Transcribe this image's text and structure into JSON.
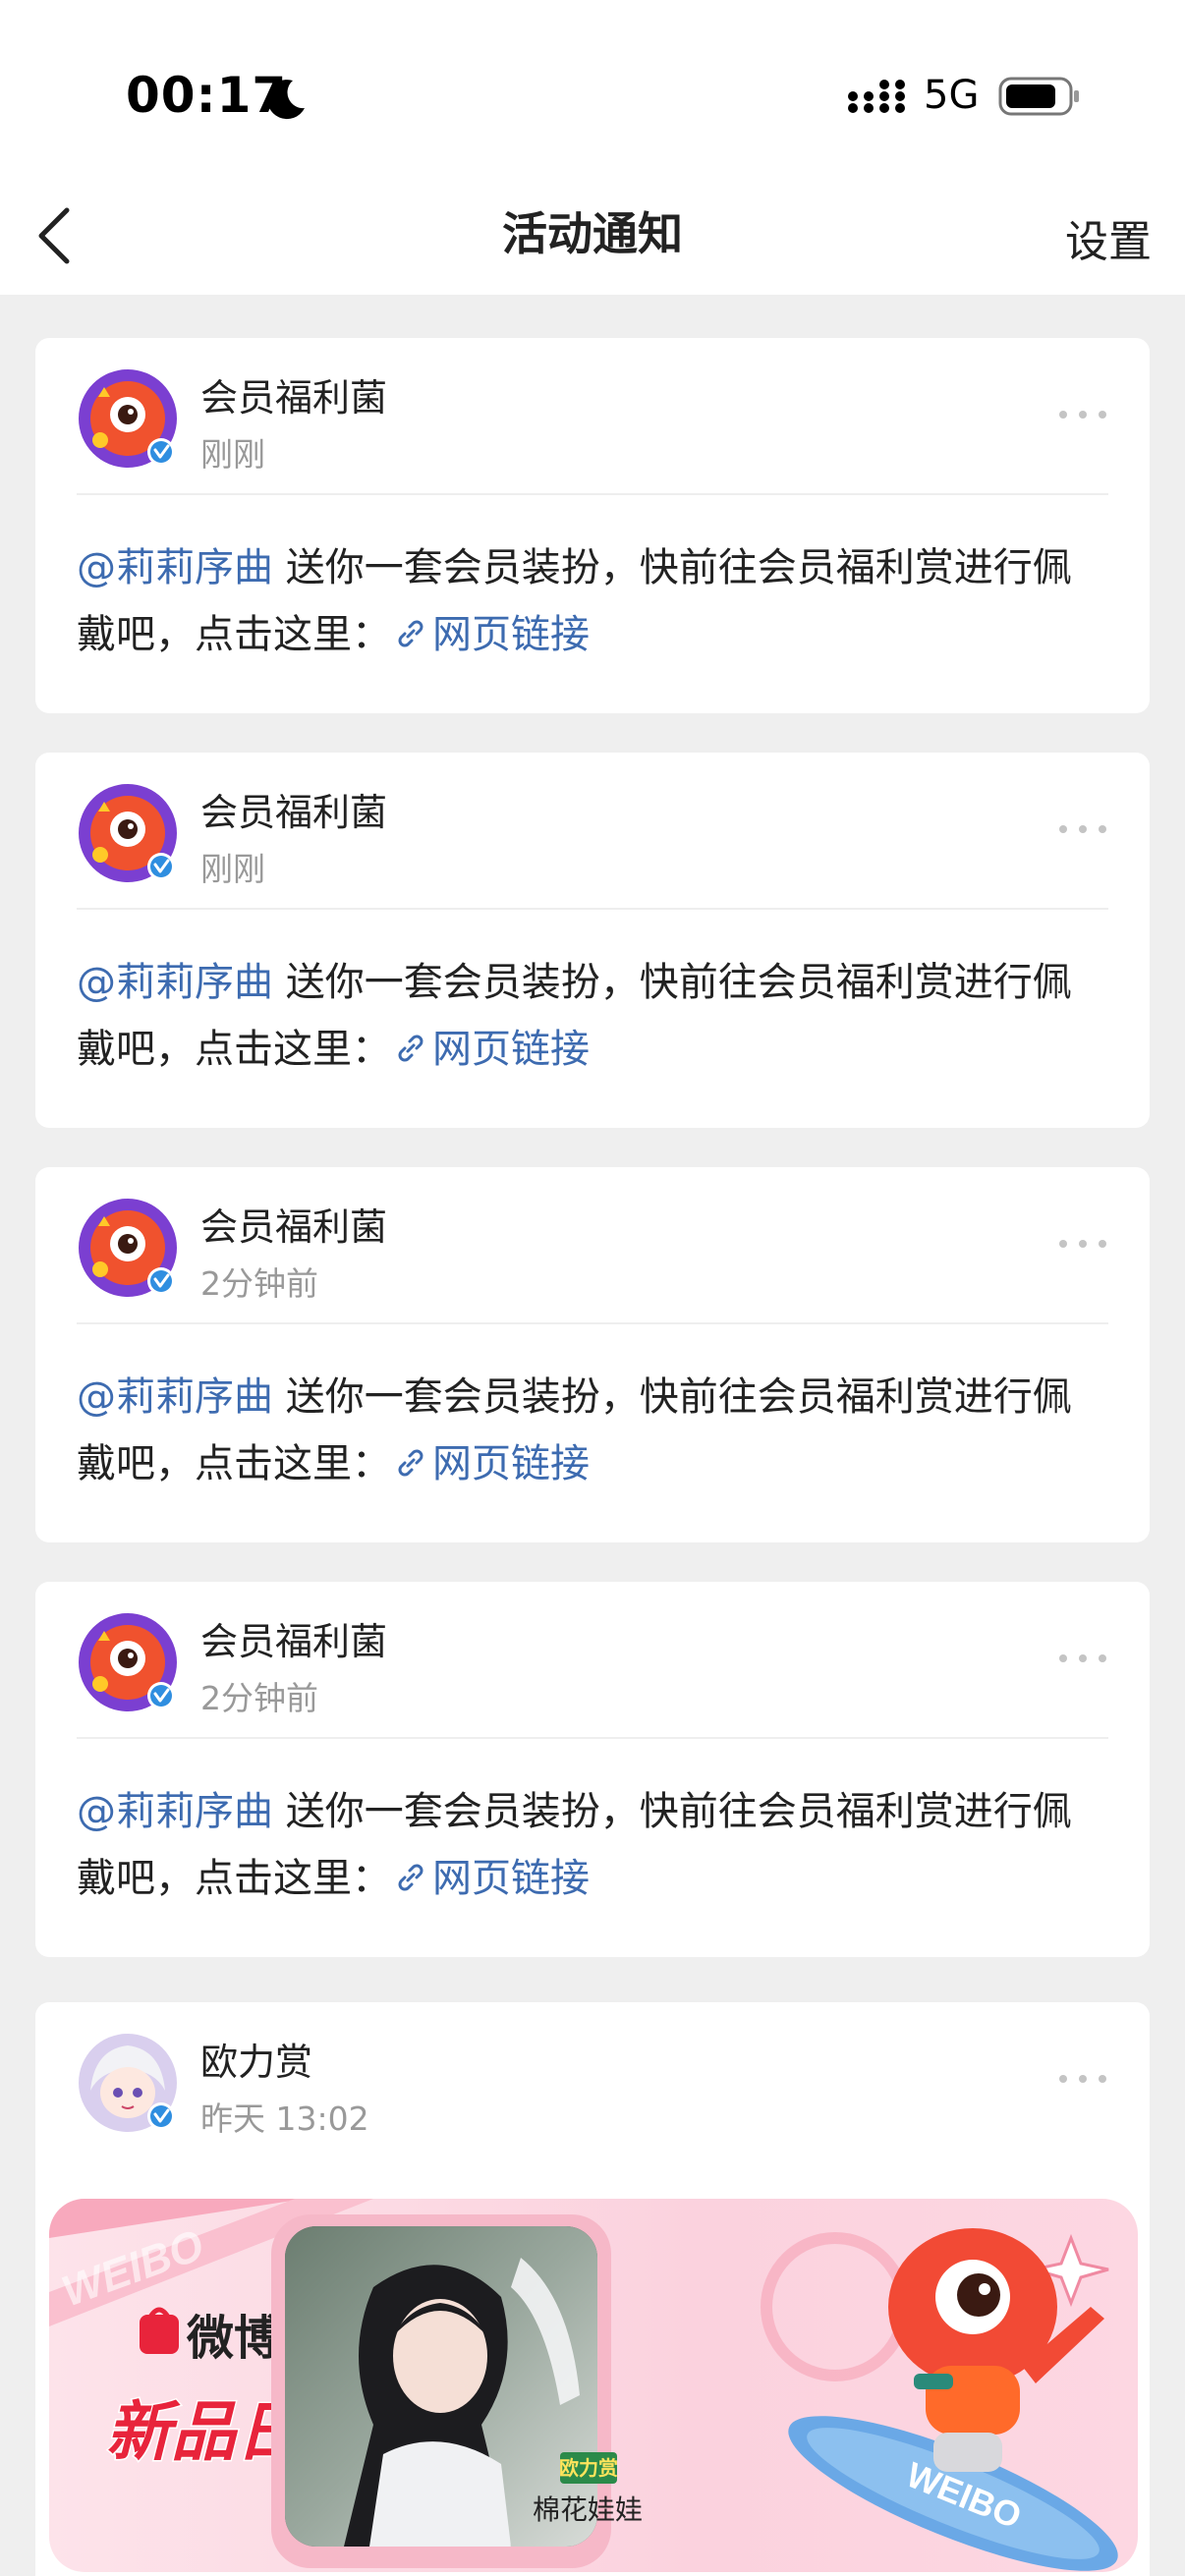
{
  "status": {
    "time": "00:17",
    "network": "5G"
  },
  "nav": {
    "title": "活动通知",
    "settings": "设置"
  },
  "notifications": [
    {
      "sender": "会员福利菌",
      "time": "刚刚",
      "mention": "@莉莉序曲",
      "text": " 送你一套会员装扮，快前往会员福利赏进行佩戴吧，点击这里：",
      "link": "网页链接"
    },
    {
      "sender": "会员福利菌",
      "time": "刚刚",
      "mention": "@莉莉序曲",
      "text": " 送你一套会员装扮，快前往会员福利赏进行佩戴吧，点击这里：",
      "link": "网页链接"
    },
    {
      "sender": "会员福利菌",
      "time": "2分钟前",
      "mention": "@莉莉序曲",
      "text": " 送你一套会员装扮，快前往会员福利赏进行佩戴吧，点击这里：",
      "link": "网页链接"
    },
    {
      "sender": "会员福利菌",
      "time": "2分钟前",
      "mention": "@莉莉序曲",
      "text": " 送你一套会员装扮，快前往会员福利赏进行佩戴吧，点击这里：",
      "link": "网页链接"
    }
  ],
  "promo": {
    "sender": "欧力赏",
    "time": "昨天 13:02",
    "banner": {
      "brand": "微博购",
      "headline": "新品日历",
      "badge": "欧力赏",
      "product": "棉花娃娃",
      "watermark": "WEIBO",
      "board_text": "WEIBO"
    }
  },
  "colors": {
    "accent_link": "#3d6bb0",
    "background": "#efefef",
    "verified": "#2f8ee0"
  }
}
